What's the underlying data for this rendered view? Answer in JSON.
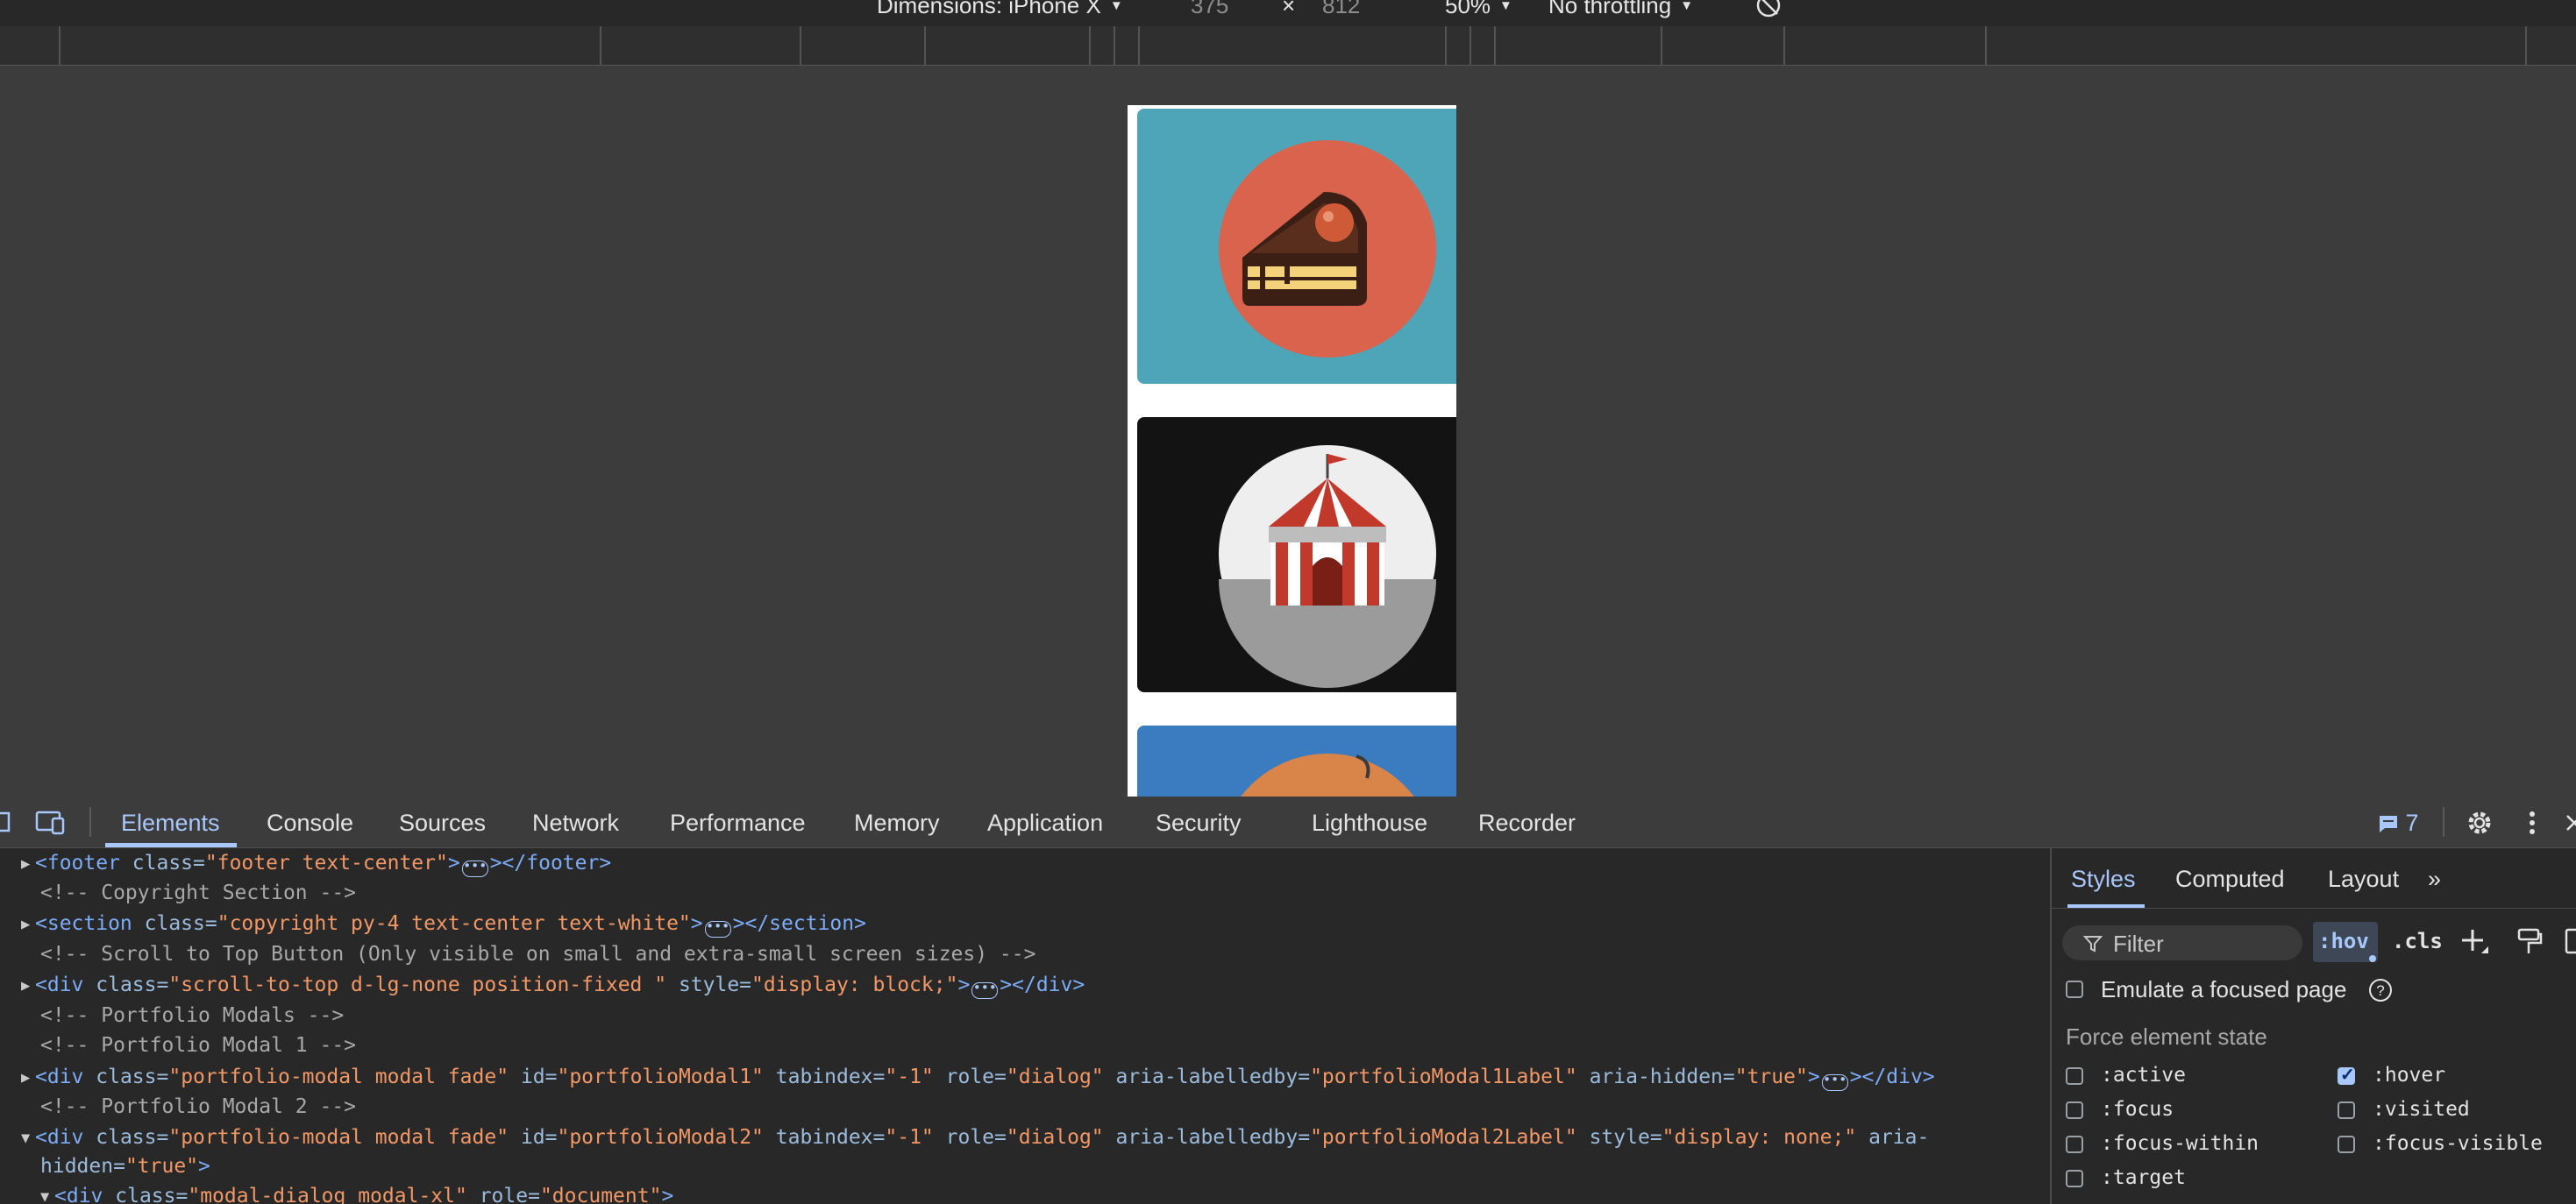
{
  "device_toolbar": {
    "dimensions_label": "Dimensions: iPhone X",
    "width": "375",
    "times": "×",
    "height": "812",
    "zoom": "50%",
    "throttling": "No throttling"
  },
  "viewport": {
    "cards": [
      {
        "name": "cake",
        "background": "#4fa5b8",
        "circle": "#d9634d"
      },
      {
        "name": "circus-tent",
        "background": "#131313",
        "circle": "#eeeeee"
      },
      {
        "name": "game-controller",
        "background": "#3a7cbf",
        "circle": "#d9854a"
      }
    ]
  },
  "devtools": {
    "tabs": [
      "Elements",
      "Console",
      "Sources",
      "Network",
      "Performance",
      "Memory",
      "Application",
      "Security",
      "Lighthouse",
      "Recorder"
    ],
    "active_tab": "Elements",
    "issues_count": "7"
  },
  "dom_tree": {
    "r1": {
      "tag": "<footer",
      "a1": "class=",
      "v1": "\"footer text-center\"",
      "close": "></footer>"
    },
    "r2": {
      "text": "<!-- Copyright Section -->"
    },
    "r3": {
      "tag": "<section",
      "a1": "class=",
      "v1": "\"copyright py-4 text-center text-white\"",
      "close": "></section>"
    },
    "r4": {
      "text": "<!-- Scroll to Top Button (Only visible on small and extra-small screen sizes) -->"
    },
    "r5": {
      "tag": "<div",
      "a1": "class=",
      "v1": "\"scroll-to-top d-lg-none position-fixed \"",
      "a2": "style=",
      "v2": "\"display: block;\"",
      "close": "></div>"
    },
    "r6": {
      "text": "<!-- Portfolio Modals -->"
    },
    "r7": {
      "text": "<!-- Portfolio Modal 1 -->"
    },
    "r8": {
      "tag": "<div",
      "a1": "class=",
      "v1": "\"portfolio-modal modal fade\"",
      "a2": "id=",
      "v2": "\"portfolioModal1\"",
      "a3": "tabindex=",
      "v3": "\"-1\"",
      "a4": "role=",
      "v4": "\"dialog\"",
      "a5": "aria-labelledby=",
      "v5": "\"portfolioModal1Label\"",
      "a6": "aria-hidden=",
      "v6": "\"true\"",
      "close": "></div>"
    },
    "r9": {
      "text": "<!-- Portfolio Modal 2 -->"
    },
    "r10": {
      "tag": "<div",
      "a1": "class=",
      "v1": "\"portfolio-modal modal fade\"",
      "a2": "id=",
      "v2": "\"portfolioModal2\"",
      "a3": "tabindex=",
      "v3": "\"-1\"",
      "a4": "role=",
      "v4": "\"dialog\"",
      "a5": "aria-labelledby=",
      "v5": "\"portfolioModal2Label\"",
      "a6": "style=",
      "v6": "\"display: none;\"",
      "a7": "aria-"
    },
    "r11": {
      "a7b": "hidden=",
      "v7": "\"true\"",
      "close": ">"
    },
    "r12": {
      "tag": "<div",
      "a1": "class=",
      "v1": "\"modal-dialog modal-xl\"",
      "a2": "role=",
      "v2": "\"document\"",
      "close": ">"
    }
  },
  "sidebar": {
    "tabs": [
      "Styles",
      "Computed",
      "Layout"
    ],
    "more": "»",
    "filter_placeholder": "Filter",
    "hov": ":hov",
    "cls": ".cls",
    "emulate_label": "Emulate a focused page",
    "force_state_title": "Force element state",
    "states": [
      {
        "label": ":active",
        "checked": false
      },
      {
        "label": ":hover",
        "checked": true
      },
      {
        "label": ":focus",
        "checked": false
      },
      {
        "label": ":visited",
        "checked": false
      },
      {
        "label": ":focus-within",
        "checked": false
      },
      {
        "label": ":focus-visible",
        "checked": false
      },
      {
        "label": ":target",
        "checked": false
      }
    ]
  }
}
